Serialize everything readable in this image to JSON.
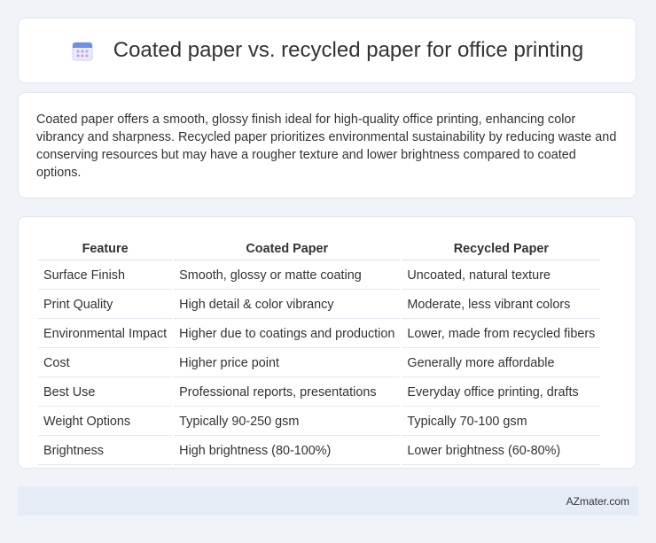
{
  "header": {
    "title": "Coated paper vs. recycled paper for office printing",
    "icon": "calendar-icon"
  },
  "intro": {
    "text": "Coated paper offers a smooth, glossy finish ideal for high-quality office printing, enhancing color vibrancy and sharpness. Recycled paper prioritizes environmental sustainability by reducing waste and conserving resources but may have a rougher texture and lower brightness compared to coated options."
  },
  "table": {
    "columns": [
      "Feature",
      "Coated Paper",
      "Recycled Paper"
    ],
    "rows": [
      [
        "Surface Finish",
        "Smooth, glossy or matte coating",
        "Uncoated, natural texture"
      ],
      [
        "Print Quality",
        "High detail & color vibrancy",
        "Moderate, less vibrant colors"
      ],
      [
        "Environmental Impact",
        "Higher due to coatings and production",
        "Lower, made from recycled fibers"
      ],
      [
        "Cost",
        "Higher price point",
        "Generally more affordable"
      ],
      [
        "Best Use",
        "Professional reports, presentations",
        "Everyday office printing, drafts"
      ],
      [
        "Weight Options",
        "Typically 90-250 gsm",
        "Typically 70-100 gsm"
      ],
      [
        "Brightness",
        "High brightness (80-100%)",
        "Lower brightness (60-80%)"
      ]
    ]
  },
  "footer": {
    "text": "AZmater.com"
  },
  "colors": {
    "background": "#f0f3f8",
    "card": "#ffffff",
    "footer_bar": "#e6ecf6"
  }
}
